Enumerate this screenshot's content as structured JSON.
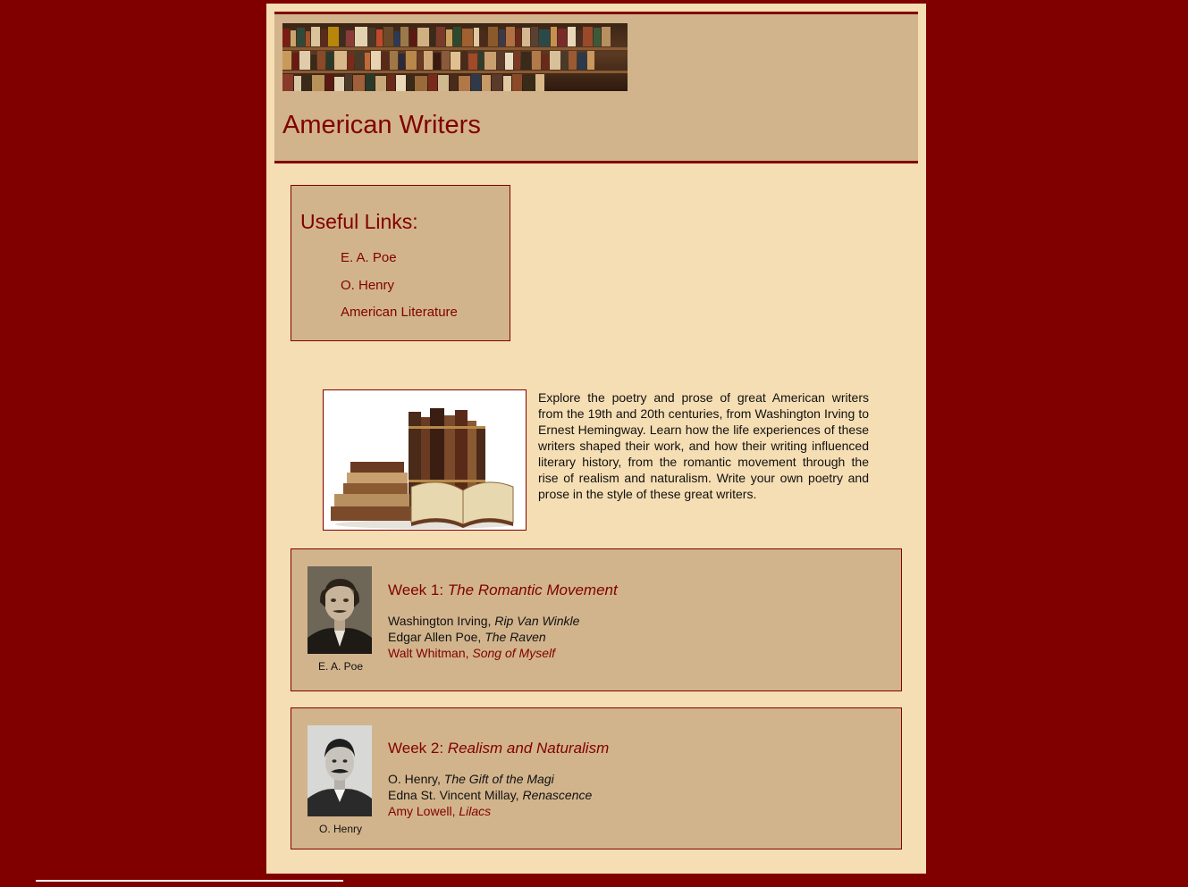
{
  "header": {
    "title": "American Writers"
  },
  "sidebar": {
    "title": "Useful Links:",
    "links": [
      "E. A. Poe",
      "O. Henry",
      "American Literature"
    ]
  },
  "intro": {
    "text": "Explore the poetry and prose of great American writers from the 19th and 20th centuries, from Washington Irving to Ernest Hemingway. Learn how the life experiences of these writers shaped their work, and how their writing influenced literary history, from the romantic movement through the rise of realism and naturalism. Write your own poetry and prose in the style of these great writers."
  },
  "weeks": [
    {
      "label": "Week 1:",
      "theme": "The Romantic Movement",
      "caption": "E. A. Poe",
      "works": [
        {
          "author": "Washington Irving,",
          "title": "Rip Van Winkle",
          "link": false
        },
        {
          "author": "Edgar Allen Poe,",
          "title": "The Raven",
          "link": false
        },
        {
          "author": "Walt Whitman,",
          "title": "Song of Myself",
          "link": true
        }
      ]
    },
    {
      "label": "Week 2:",
      "theme": "Realism and Naturalism",
      "caption": "O. Henry",
      "works": [
        {
          "author": "O. Henry,",
          "title": "The Gift of the Magi",
          "link": false
        },
        {
          "author": "Edna St. Vincent Millay,",
          "title": "Renascence",
          "link": false
        },
        {
          "author": "Amy Lowell,",
          "title": "Lilacs",
          "link": true
        }
      ]
    }
  ],
  "colors": {
    "background": "#800000",
    "page": "#f5deb3",
    "panel": "#d2b48c",
    "accent": "#800000"
  }
}
